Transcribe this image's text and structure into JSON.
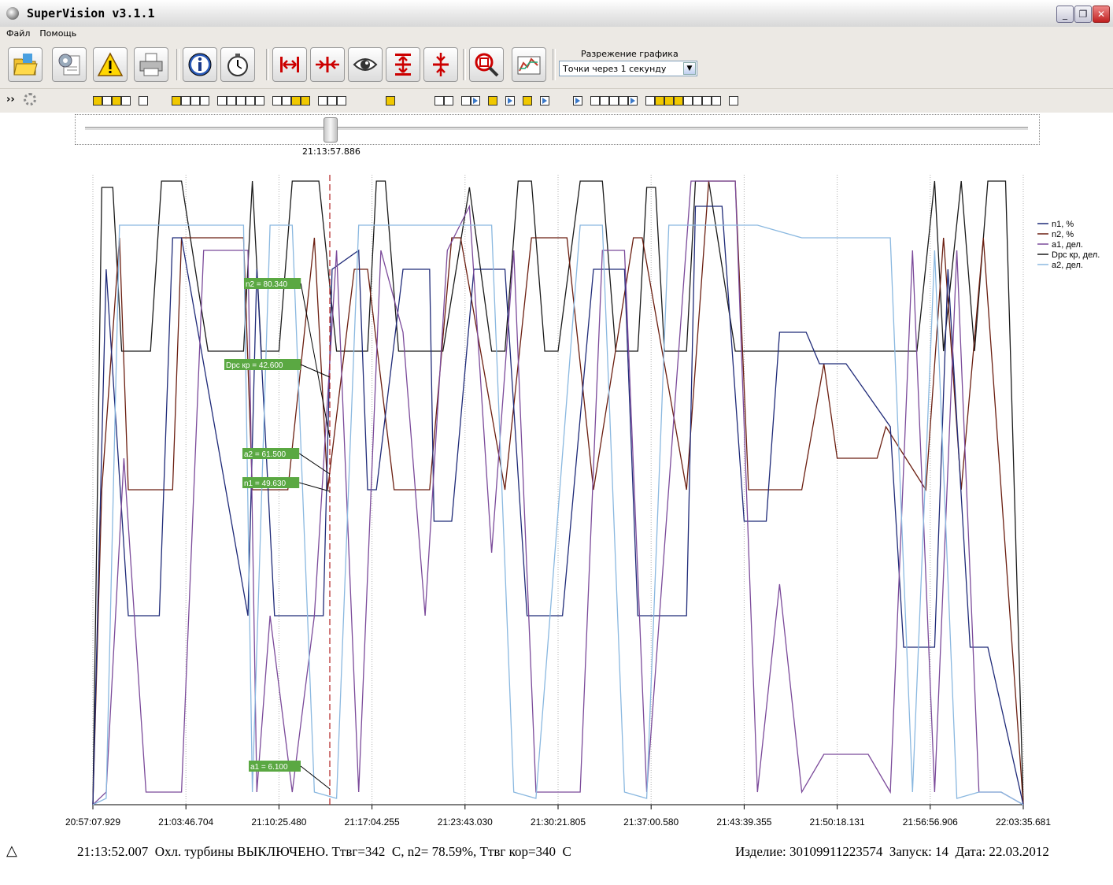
{
  "window": {
    "title": "SuperVision v3.1.1"
  },
  "menu": [
    "Файл",
    "Помощь"
  ],
  "toolbar": {
    "buttons": [
      "open-folder-icon",
      "settings-icon",
      "warning-icon",
      "printer-icon",
      "info-icon",
      "stopwatch-icon",
      "zoom-in-time-icon",
      "zoom-out-time-icon",
      "view-eye-icon",
      "zoom-in-value-icon",
      "zoom-out-value-icon",
      "zoom-fit-icon",
      "chart-properties-icon"
    ],
    "resolution_label": "Разрежение графика",
    "resolution_value": "Точки через 1 секунду"
  },
  "slider": {
    "cursor_time": "21:13:57.886",
    "position": 0.257
  },
  "chart_data": {
    "type": "line",
    "x_ticks": [
      "20:57:07.929",
      "21:03:46.704",
      "21:10:25.480",
      "21:17:04.255",
      "21:23:43.030",
      "21:30:21.805",
      "21:37:00.580",
      "21:43:39.355",
      "21:50:18.131",
      "21:56:56.906",
      "22:03:35.681"
    ],
    "legend": [
      "n1, %",
      "n2, %",
      "a1, дел.",
      "Dpc кр, дел.",
      "a2, дел."
    ],
    "legend_placement": "right",
    "colors": {
      "n1": "#1f2a78",
      "n2": "#6b1e10",
      "a1": "#7b4a9a",
      "dpc": "#1a1a1a",
      "a2": "#8ab8e0"
    },
    "annotations": [
      "n2 = 80.340",
      "Dpc кр = 42.600",
      "a2 = 61.500",
      "n1 = 49.630",
      "a1 = 6.100"
    ],
    "cursor_time": "21:13:57.886",
    "series": [
      {
        "name": "Dpc кр, дел.",
        "x": [
          0,
          0.2,
          0.45,
          0.65,
          0.85,
          1.3,
          1.55,
          2.0,
          2.6,
          3.4,
          3.6,
          3.8,
          3.9,
          4.2,
          4.5,
          5.1,
          5.5,
          5.7,
          6.2,
          6.4,
          6.6,
          6.9,
          7.0,
          7.5,
          7.6,
          7.9,
          8.5,
          9.0,
          9.3,
          9.6,
          9.9,
          10.2,
          10.5,
          11.0,
          11.5,
          11.8,
          12.1,
          12.3,
          12.5,
          12.7,
          12.9,
          13.4,
          13.6,
          13.9,
          14.5,
          15.2,
          15.5,
          16.0,
          17.0,
          17.8,
          18.6,
          19.0,
          19.2,
          19.6,
          19.9,
          20.2,
          20.6,
          21.0
        ],
        "y": [
          0,
          98,
          98,
          72,
          72,
          72,
          99,
          99,
          72,
          72,
          99,
          72,
          72,
          72,
          99,
          99,
          72,
          72,
          72,
          99,
          99,
          72,
          72,
          72,
          72,
          72,
          98,
          72,
          72,
          99,
          99,
          72,
          72,
          99,
          99,
          72,
          72,
          72,
          98,
          98,
          72,
          72,
          99,
          99,
          72,
          72,
          72,
          72,
          72,
          72,
          72,
          99,
          72,
          99,
          72,
          99,
          99,
          0
        ]
      },
      {
        "name": "n2, %",
        "x": [
          0,
          0.2,
          0.6,
          0.8,
          1.3,
          1.8,
          2.0,
          3.4,
          3.6,
          3.9,
          4.4,
          5.0,
          5.3,
          5.9,
          6.2,
          6.8,
          7.6,
          8.1,
          8.3,
          9.3,
          9.9,
          10.7,
          11.3,
          12.2,
          12.4,
          13.4,
          13.9,
          14.5,
          14.8,
          15.4,
          16.0,
          16.5,
          16.8,
          17.7,
          17.9,
          18.8,
          19.2,
          19.6,
          20.1,
          20.5,
          21.0
        ],
        "y": [
          0,
          50,
          90,
          50,
          50,
          50,
          90,
          90,
          50,
          50,
          50,
          90,
          50,
          85,
          85,
          50,
          50,
          90,
          90,
          50,
          90,
          90,
          50,
          90,
          90,
          50,
          99,
          99,
          50,
          50,
          50,
          70,
          55,
          55,
          60,
          50,
          90,
          50,
          90,
          50,
          0
        ]
      },
      {
        "name": "n1, %",
        "x": [
          0,
          0.3,
          0.8,
          1.5,
          1.8,
          2.0,
          3.5,
          3.7,
          4.1,
          5.2,
          5.4,
          6.0,
          6.2,
          6.4,
          7.0,
          7.6,
          7.7,
          8.1,
          8.6,
          9.3,
          9.8,
          10.6,
          11.3,
          12.0,
          12.3,
          13.4,
          13.6,
          14.2,
          14.7,
          15.2,
          15.5,
          16.1,
          16.4,
          17.0,
          17.5,
          18.0,
          18.3,
          19.0,
          19.3,
          19.8,
          20.2,
          21.0
        ],
        "y": [
          0,
          85,
          30,
          30,
          90,
          90,
          30,
          85,
          30,
          30,
          85,
          88,
          50,
          50,
          85,
          85,
          45,
          45,
          85,
          85,
          30,
          30,
          85,
          85,
          30,
          30,
          95,
          95,
          45,
          45,
          75,
          75,
          70,
          70,
          65,
          60,
          25,
          25,
          85,
          25,
          25,
          0
        ]
      },
      {
        "name": "a1, дел.",
        "x": [
          0,
          0.3,
          0.7,
          1.2,
          2.0,
          2.5,
          3.5,
          3.7,
          4.0,
          4.5,
          5.0,
          5.5,
          6.0,
          6.5,
          7.0,
          7.5,
          8.0,
          8.5,
          9.0,
          9.5,
          10.0,
          11.0,
          11.5,
          12.0,
          12.5,
          13.5,
          14.5,
          15.0,
          15.5,
          16.0,
          16.5,
          17.5,
          18.0,
          18.5,
          19.0,
          19.5,
          20.0,
          20.5,
          21.0
        ],
        "y": [
          0,
          2,
          55,
          2,
          2,
          88,
          88,
          2,
          30,
          2,
          30,
          88,
          2,
          88,
          75,
          30,
          88,
          95,
          40,
          88,
          2,
          2,
          88,
          88,
          2,
          99,
          99,
          2,
          35,
          2,
          8,
          8,
          2,
          88,
          2,
          88,
          2,
          2,
          0
        ]
      },
      {
        "name": "a2, дел.",
        "x": [
          0,
          0.3,
          0.6,
          1.5,
          2.0,
          3.4,
          3.6,
          4.0,
          4.5,
          5.0,
          5.5,
          6.0,
          6.5,
          7.0,
          8.0,
          9.0,
          9.5,
          10.0,
          11.0,
          11.5,
          12.0,
          12.5,
          13.0,
          14.0,
          15.0,
          16.0,
          17.0,
          18.0,
          18.5,
          19.0,
          19.5,
          20.0,
          20.5,
          21.0
        ],
        "y": [
          0,
          1,
          92,
          92,
          92,
          92,
          2,
          92,
          92,
          2,
          1,
          92,
          92,
          92,
          92,
          92,
          2,
          1,
          92,
          92,
          2,
          1,
          92,
          92,
          92,
          90,
          90,
          90,
          2,
          88,
          1,
          2,
          2,
          0
        ]
      }
    ]
  },
  "status": {
    "message": "21:13:52.007  Охл. турбины ВЫКЛЮЧЕНО. Ттвг=342  С, n2= 78.59%, Ттвг кор=340  С",
    "info": "Изделие: 30109911223574  Запуск: 14  Дата: 22.03.2012"
  }
}
